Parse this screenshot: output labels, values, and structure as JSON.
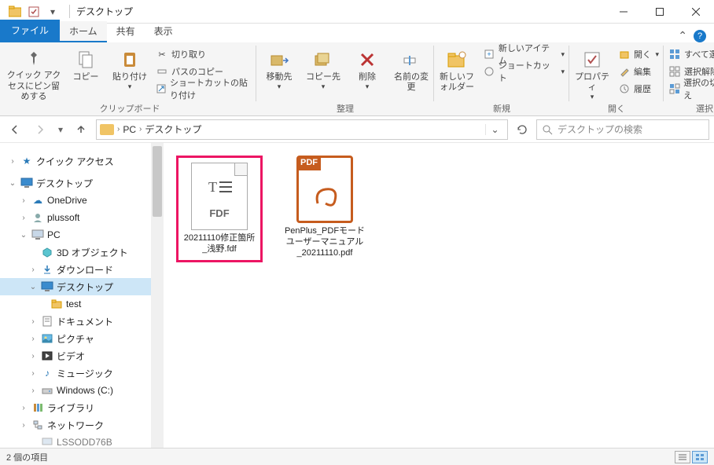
{
  "title": "デスクトップ",
  "tabs": {
    "file": "ファイル",
    "home": "ホーム",
    "share": "共有",
    "view": "表示"
  },
  "ribbon": {
    "clipboard": {
      "pin": "クイック アクセスにピン留めする",
      "copy": "コピー",
      "paste": "貼り付け",
      "cut": "切り取り",
      "copy_path": "パスのコピー",
      "paste_shortcut": "ショートカットの貼り付け",
      "label": "クリップボード"
    },
    "organize": {
      "move_to": "移動先",
      "copy_to": "コピー先",
      "delete": "削除",
      "rename": "名前の変更",
      "label": "整理"
    },
    "new": {
      "new_folder": "新しいフォルダー",
      "new_item": "新しいアイテム",
      "easy_access": "ショートカット",
      "label": "新規"
    },
    "open": {
      "properties": "プロパティ",
      "open": "開く",
      "edit": "編集",
      "history": "履歴",
      "label": "開く"
    },
    "select": {
      "select_all": "すべて選択",
      "select_none": "選択解除",
      "invert": "選択の切り替え",
      "label": "選択"
    }
  },
  "breadcrumb": {
    "pc": "PC",
    "desktop": "デスクトップ"
  },
  "search_placeholder": "デスクトップの検索",
  "nav": {
    "quick_access": "クイック アクセス",
    "desktop_top": "デスクトップ",
    "onedrive": "OneDrive",
    "plussoft": "plussoft",
    "pc": "PC",
    "objects3d": "3D オブジェクト",
    "downloads": "ダウンロード",
    "desktop": "デスクトップ",
    "test": "test",
    "documents": "ドキュメント",
    "pictures": "ピクチャ",
    "videos": "ビデオ",
    "music": "ミュージック",
    "windows_c": "Windows (C:)",
    "library": "ライブラリ",
    "network": "ネットワーク",
    "truncated": "LSSODD76B"
  },
  "files": {
    "fdf": {
      "name": "20211110修正箇所_浅野.fdf",
      "fdf_badge": "FDF"
    },
    "pdf": {
      "name": "PenPlus_PDFモードユーザーマニュアル_20211110.pdf",
      "pdf_badge": "PDF"
    }
  },
  "status": {
    "count": "2 個の項目"
  }
}
